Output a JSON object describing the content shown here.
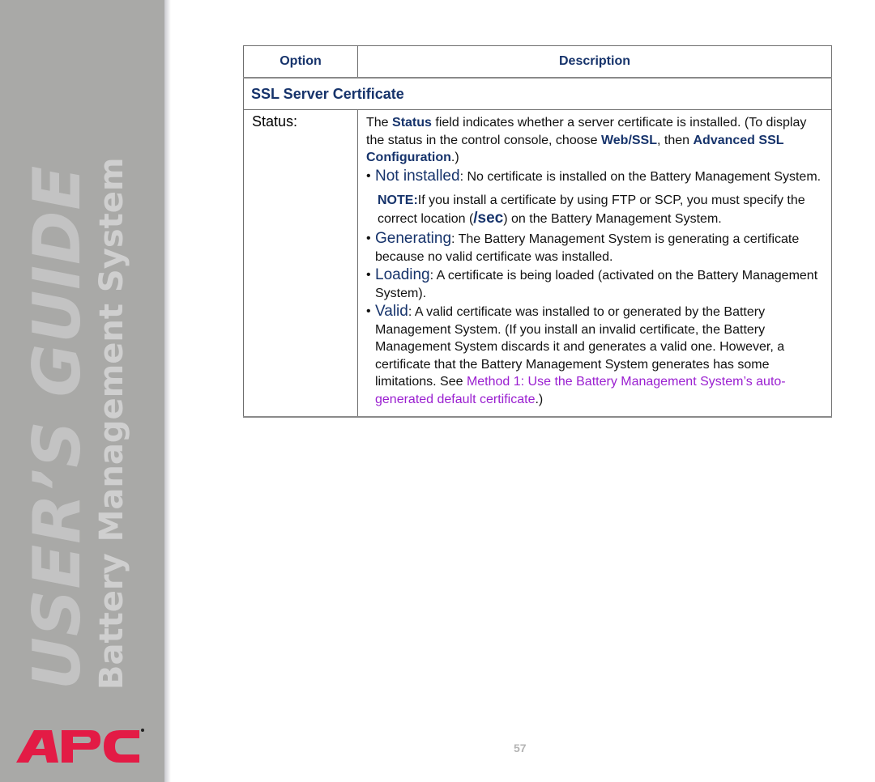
{
  "sidebar": {
    "guide_title": "USER’S GUIDE",
    "guide_subtitle": "Battery Management System",
    "logo_text": "APC",
    "logo_color": "#e31b45",
    "background_color": "#a9a9a7"
  },
  "table": {
    "headers": {
      "option": "Option",
      "description": "Description"
    },
    "section_title": "SSL Server Certificate",
    "rows": [
      {
        "option": "Status:",
        "intro": {
          "t1": "The ",
          "b1": "Status",
          "t2": " field indicates whether a server certificate is installed. (To display the status in the control console, choose ",
          "b2": "Web/SSL",
          "t3": ", then ",
          "b3": "Advanced SSL Configuration",
          "t4": ".)"
        },
        "items": [
          {
            "term": "Not installed",
            "text": ": No certificate is installed on the Battery Management System."
          }
        ],
        "note": {
          "label": "NOTE:",
          "t1": "If you install a certificate by using FTP or SCP, you must specify the correct location (",
          "code": "/sec",
          "t2": ") on the Battery Management System."
        },
        "items2": [
          {
            "term": "Generating",
            "text": ": The Battery Management System is generating a certificate because no valid certificate was installed."
          },
          {
            "term": "Loading",
            "text": ": A certificate is being loaded (activated on the Battery Management System)."
          },
          {
            "term": "Valid",
            "text": ": A valid certificate was installed to or generated by the Battery Management System. (If you install an invalid certificate, the Battery Management System discards it and generates a valid one. However, a certificate that the Battery Management System generates has some limitations. See ",
            "link": "Method 1: Use the Battery Management System’s auto-generated default certificate",
            "tail": ".)"
          }
        ]
      }
    ]
  },
  "colors": {
    "heading": "#16336b",
    "link": "#9a1fd0"
  },
  "footer": {
    "page_number": "57"
  }
}
